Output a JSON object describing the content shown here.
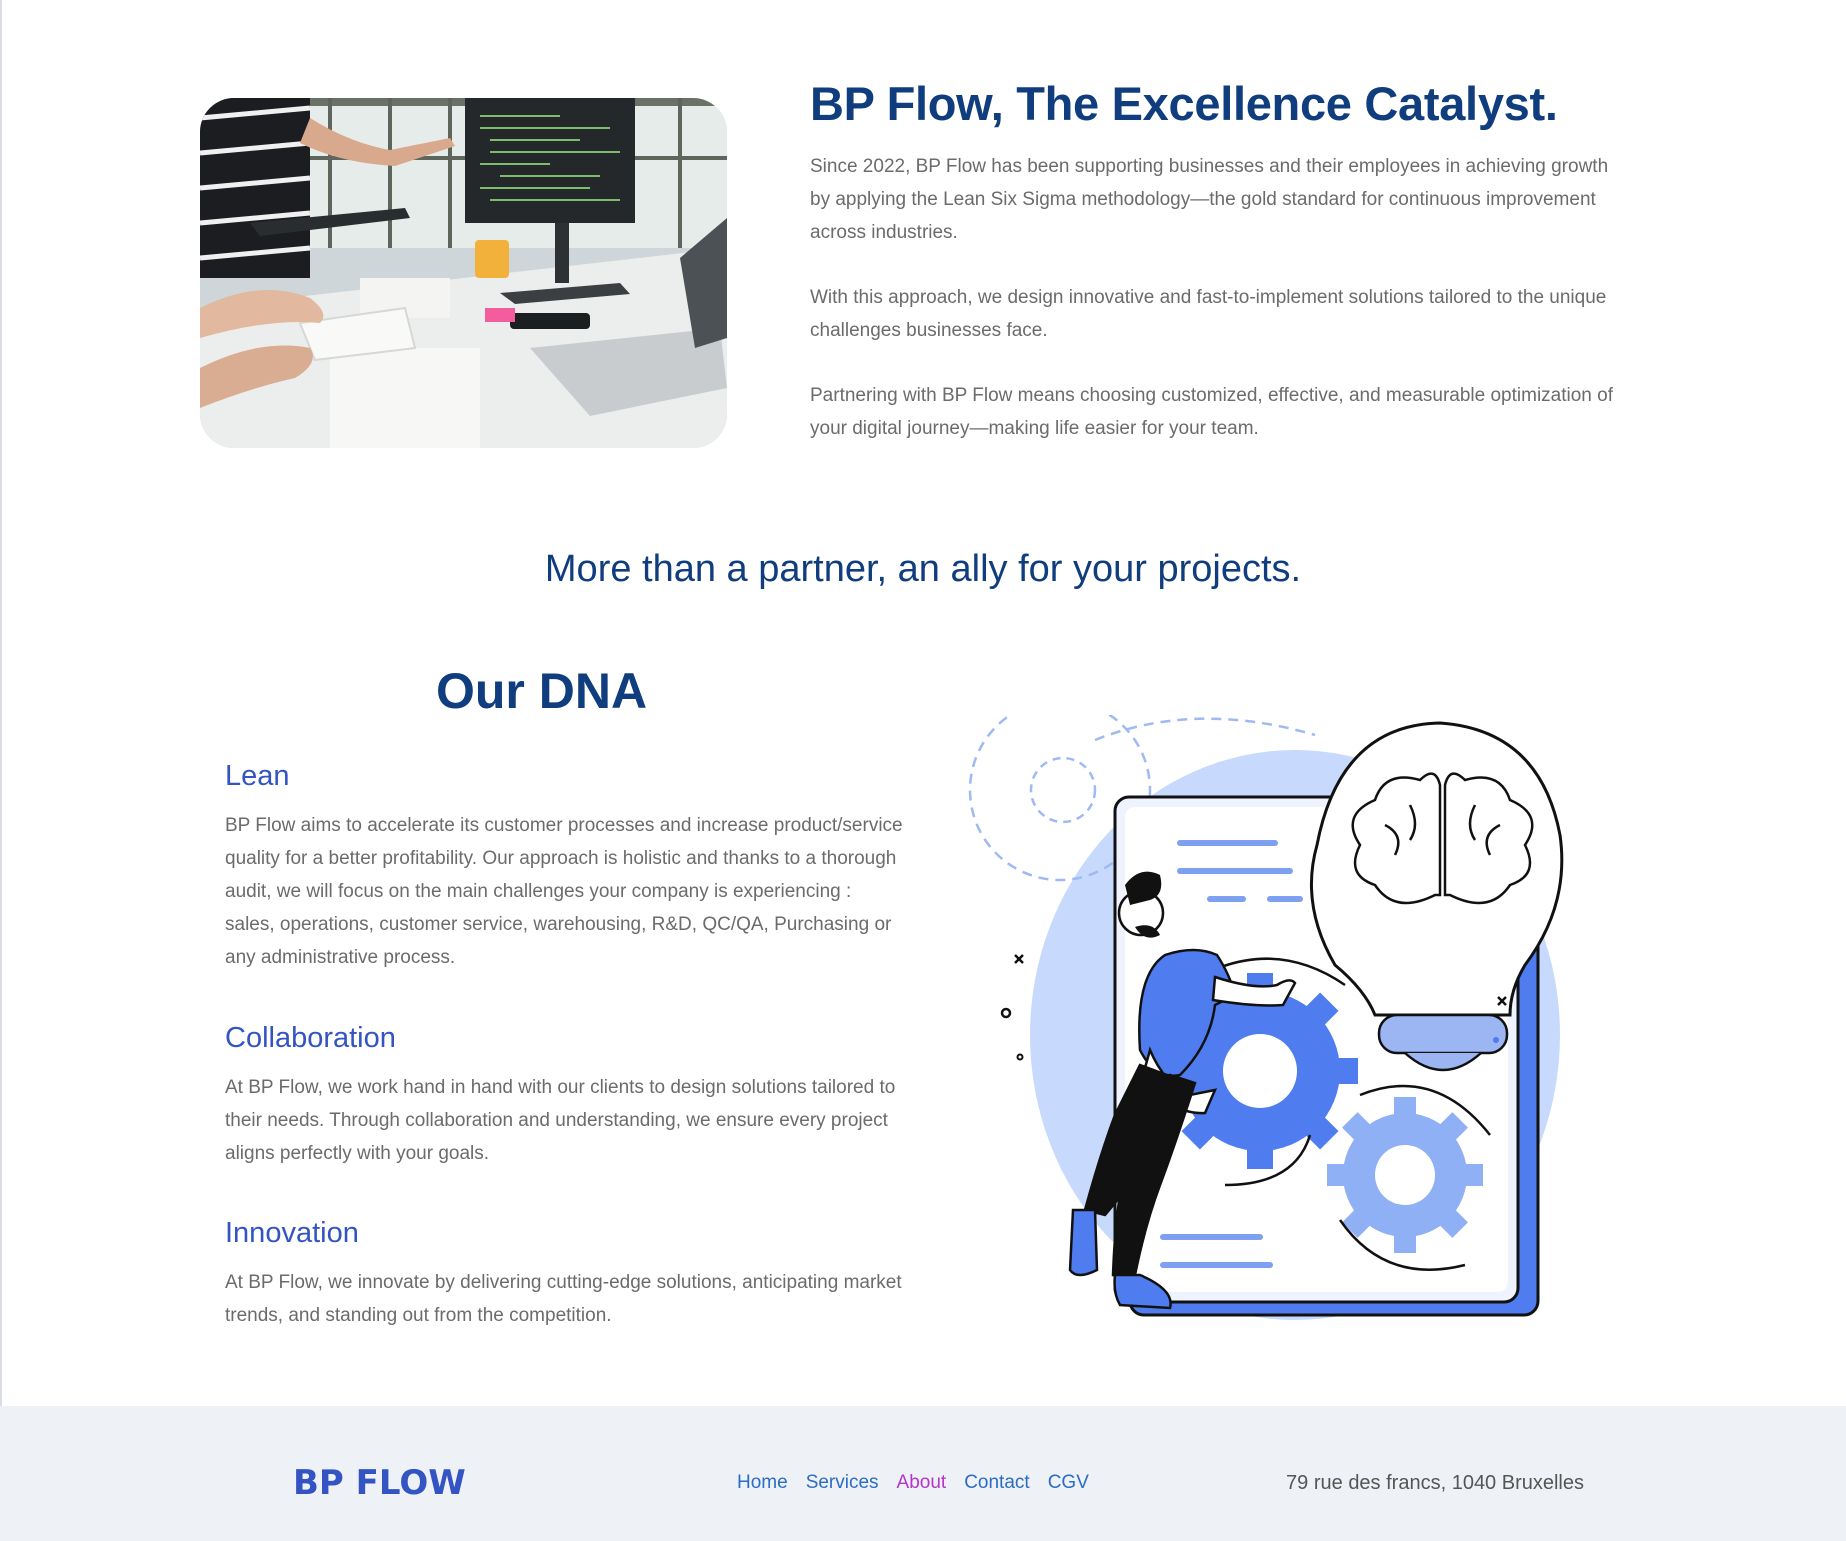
{
  "intro": {
    "title": "BP Flow, The Excellence Catalyst.",
    "paragraphs": [
      "Since 2022, BP Flow has been supporting businesses and their employees in achieving growth by applying the Lean Six Sigma methodology—the gold standard for continuous improvement across industries.",
      "With this approach, we design innovative and fast-to-implement solutions tailored to the unique challenges businesses face.",
      "Partnering with BP Flow means choosing customized, effective, and measurable optimization of your digital journey—making life easier for your team."
    ]
  },
  "tagline": "More than a partner, an ally for your projects.",
  "dna": {
    "title": "Our DNA",
    "pillars": [
      {
        "heading": "Lean",
        "text": "BP Flow aims to accelerate its customer processes and increase product/service quality for a better profitability. Our approach is holistic and thanks to a thorough audit, we will focus on the main challenges your company is experiencing : sales, operations, customer service, warehousing, R&D, QC/QA, Purchasing or any administrative process."
      },
      {
        "heading": "Collaboration",
        "text": "At BP Flow, we work hand in hand with our clients to design solutions tailored to their needs. Through collaboration and understanding, we ensure every project aligns perfectly with your goals."
      },
      {
        "heading": "Innovation",
        "text": "At BP Flow, we innovate by delivering cutting-edge solutions, anticipating market trends, and standing out from the competition."
      }
    ]
  },
  "footer": {
    "logo": "BP FLOW",
    "nav": [
      "Home",
      "Services",
      "About",
      "Contact",
      "CGV"
    ],
    "active_nav": "About",
    "address": "79 rue des francs, 1040 Bruxelles"
  },
  "colors": {
    "heading": "#0f3d7d",
    "subheading": "#3354c2",
    "body_text": "#6b6b6b",
    "link": "#2b6cc4",
    "active_link": "#b435c9",
    "footer_bg": "#eef2f7"
  }
}
